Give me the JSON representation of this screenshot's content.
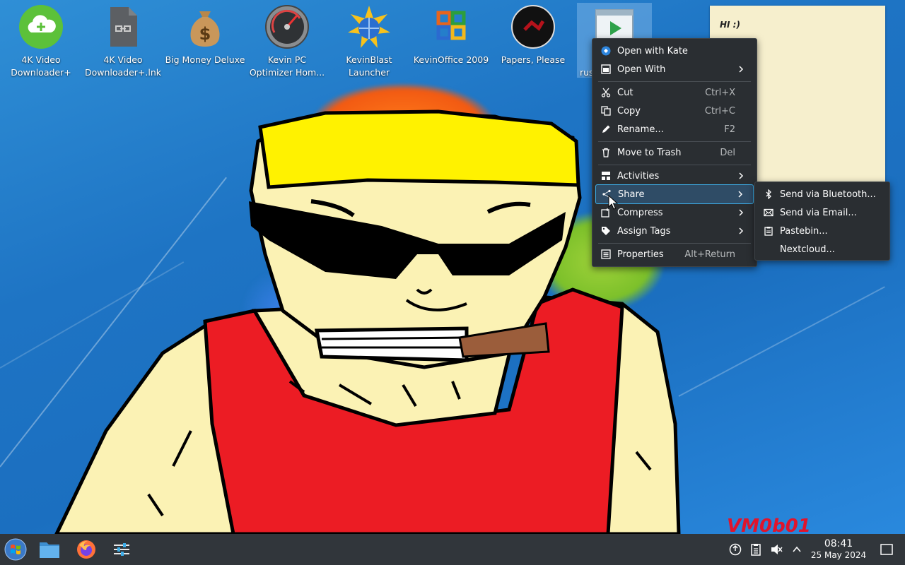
{
  "desktop": {
    "icons": [
      {
        "label": "4K Video Downloader+",
        "icon": "cloud-download-icon"
      },
      {
        "label": "4K Video Downloader+.lnk",
        "icon": "link-file-icon"
      },
      {
        "label": "Big Money Deluxe",
        "icon": "money-bag-icon"
      },
      {
        "label": "Kevin PC Optimizer Hom...",
        "icon": "speedometer-icon"
      },
      {
        "label": "KevinBlast Launcher",
        "icon": "globe-burst-icon"
      },
      {
        "label": "KevinOffice 2009",
        "icon": "office-logo-icon"
      },
      {
        "label": "Papers, Please",
        "icon": "game-seal-icon"
      },
      {
        "label": "rus",
        "icon": "executable-icon"
      }
    ],
    "note_text": "HI :)",
    "watermark": "VM0b01"
  },
  "context_menu": {
    "items": [
      {
        "label": "Open with Kate",
        "shortcut": "",
        "icon": "kate-icon"
      },
      {
        "label": "Open With",
        "shortcut": "",
        "icon": "open-with-icon"
      },
      {
        "label": "Cut",
        "shortcut": "Ctrl+X",
        "icon": "scissors-icon"
      },
      {
        "label": "Copy",
        "shortcut": "Ctrl+C",
        "icon": "copy-icon"
      },
      {
        "label": "Rename...",
        "shortcut": "F2",
        "icon": "pencil-icon"
      },
      {
        "label": "Move to Trash",
        "shortcut": "Del",
        "icon": "trash-icon"
      },
      {
        "label": "Activities",
        "shortcut": "",
        "icon": "activities-icon"
      },
      {
        "label": "Share",
        "shortcut": "",
        "icon": "share-icon"
      },
      {
        "label": "Compress",
        "shortcut": "",
        "icon": "compress-icon"
      },
      {
        "label": "Assign Tags",
        "shortcut": "",
        "icon": "tag-icon"
      },
      {
        "label": "Properties",
        "shortcut": "Alt+Return",
        "icon": "properties-icon"
      }
    ]
  },
  "share_submenu": {
    "items": [
      {
        "label": "Send via Bluetooth...",
        "icon": "bluetooth-icon"
      },
      {
        "label": "Send via Email...",
        "icon": "email-icon"
      },
      {
        "label": "Pastebin...",
        "icon": "clipboard-icon"
      },
      {
        "label": "Nextcloud...",
        "icon": ""
      }
    ]
  },
  "taskbar": {
    "time": "08:41",
    "date": "25 May 2024"
  },
  "colors": {
    "menu_bg": "#2a2e32",
    "highlight": "#3daee9",
    "taskbar_bg": "#31363b"
  }
}
